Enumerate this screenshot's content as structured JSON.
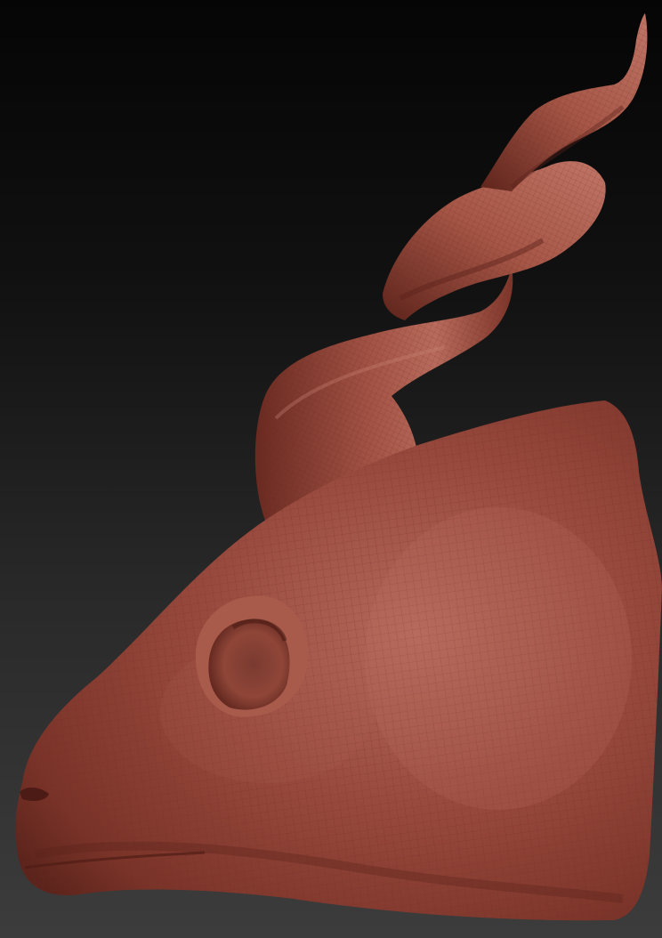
{
  "scene": {
    "subject": "sculpted-antelope-head",
    "colors": {
      "background_top": "#050505",
      "background_bottom": "#3c3c3c",
      "clay_base": "#8a3f33",
      "clay_shadow": "#5a221b",
      "clay_highlight": "#b96a5c",
      "wireframe": "#6b2c24"
    }
  }
}
